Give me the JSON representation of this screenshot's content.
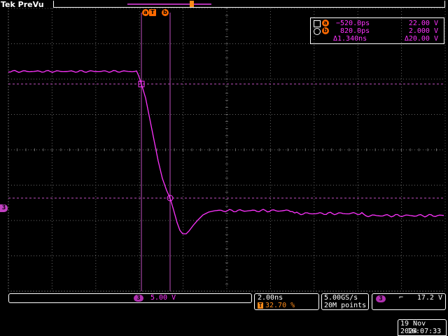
{
  "brand": {
    "label": "Tek PreVu"
  },
  "colors": {
    "trace": "#ff33ff",
    "cursor": "#ff8c1a",
    "grid": "#666666",
    "background": "#000000"
  },
  "trigger_marker": {
    "label_a": "a",
    "label_t": "T",
    "label_b": "b"
  },
  "cursor_readout": {
    "a": {
      "marker": "a",
      "time": "−520.0ps",
      "voltage": "22.00 V"
    },
    "b": {
      "marker": "b",
      "time": "820.0ps",
      "voltage": "2.000 V"
    },
    "delta": {
      "time": "Δ1.340ns",
      "voltage": "Δ20.00 V"
    }
  },
  "channel": {
    "number": "3",
    "scale": "5.00 V",
    "ground_marker": "3"
  },
  "timebase": {
    "scale": "2.00ns",
    "trigger_pos_icon": "T",
    "trigger_pos": "32.70 %"
  },
  "acquisition": {
    "sample_rate": "5.00GS/s",
    "record_length": "20M points"
  },
  "trigger": {
    "source": "3",
    "slope_icon": "falling-edge-icon",
    "slope_glyph": "⌐",
    "level": "17.2 V"
  },
  "datetime": {
    "date": "19 Nov 2024",
    "time": "16:07:33"
  }
}
